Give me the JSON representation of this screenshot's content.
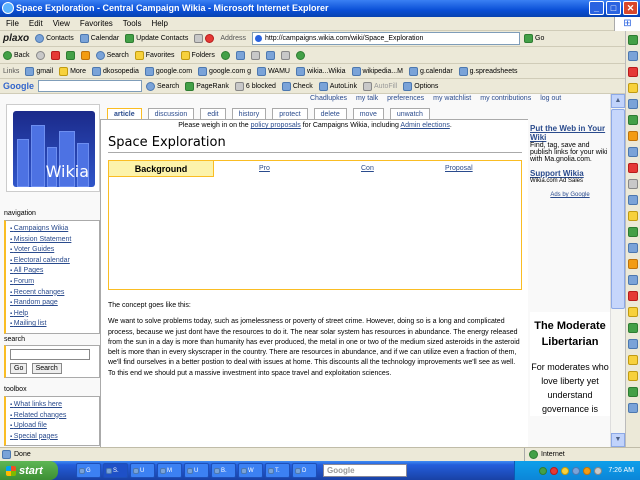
{
  "window": {
    "title": "Space Exploration - Central Campaign Wikia - Microsoft Internet Explorer"
  },
  "menu": [
    "File",
    "Edit",
    "View",
    "Favorites",
    "Tools",
    "Help"
  ],
  "plaxo_bar": {
    "brand": "plaxo",
    "contacts": "Contacts",
    "calendar": "Calendar",
    "update": "Update Contacts"
  },
  "address": {
    "label": "Address",
    "url": "http://campaigns.wikia.com/wiki/Space_Exploration",
    "go": "Go"
  },
  "nav_toolbar": {
    "back": "Back",
    "search": "Search",
    "favorites": "Favorites",
    "folders": "Folders"
  },
  "links_bar": {
    "label": "Links",
    "items": [
      "gmail",
      "More",
      "dkosopedia",
      "google.com",
      "google.com g",
      "WAMU",
      "wikia...Wikia",
      "wikipedia...M",
      "g.calendar",
      "g.spreadsheets"
    ]
  },
  "google_bar": {
    "brand": "Google",
    "search": "Search",
    "pagerank": "PageRank",
    "blocked": "6 blocked",
    "check": "Check",
    "autolink": "AutoLink",
    "autofill": "AutoFill",
    "options": "Options"
  },
  "user_links": [
    "Chadlupkes",
    "my talk",
    "preferences",
    "my watchlist",
    "my contributions",
    "log out"
  ],
  "page_tabs": [
    "article",
    "discussion",
    "edit",
    "history",
    "protect",
    "delete",
    "move",
    "unwatch"
  ],
  "logo_text": "Wikia",
  "sitenotice": {
    "before": "Please weigh in on the ",
    "link1": "policy proposals",
    "middle": " for Campaigns Wikia, including ",
    "link2": "Admin elections",
    "after": "."
  },
  "page_title": "Space Exploration",
  "content_tabs": [
    "Background",
    "Pro",
    "Con",
    "Proposal"
  ],
  "body": {
    "intro": "The concept goes like this:",
    "paragraph": "We want to solve problems today, such as jomelessness or poverty of street crime. However, doing so is a long and complicated process, because we just dont have the resources to do it. The near solar system has resources in abundance. The energy released from the sun in a day is more than humanity has ever produced, the metal in one or two of the medium sized asteroids in the asteroid belt is more than in every skyscraper in the country. There are resources in abundance, and if we can utilize even a fraction of them, we'll find ourselves in a better postion to deal with issues at home. This discounts all the technology improvements we'll see as well. To this end we should put a massive investment into space travel and exploitation sciences."
  },
  "navigation": {
    "title": "navigation",
    "items": [
      "Campaigns Wikia",
      "Mission Statement",
      "Voter Guides",
      "Electoral calendar",
      "All Pages",
      "Forum",
      "Recent changes",
      "Random page",
      "Help",
      "Mailing list"
    ]
  },
  "search_box": {
    "title": "search",
    "go": "Go",
    "search": "Search"
  },
  "toolbox": {
    "title": "toolbox",
    "items": [
      "What links here",
      "Related changes",
      "Upload file",
      "Special pages"
    ]
  },
  "ads": [
    {
      "title": "Put the Web in Your Wiki",
      "text": "Find, tag, save and publish links for your wiki with Ma.gnolia.com.",
      "domain": ""
    },
    {
      "title": "Support Wikia",
      "text": "",
      "domain": "Wikia.com Ad Sales"
    }
  ],
  "ads_by": "Ads by Google",
  "promo": {
    "heading": "The Moderate Libertarian",
    "text": "For moderates who love liberty yet understand governance is"
  },
  "status": {
    "text": "Done",
    "zone": "Internet"
  },
  "taskbar": {
    "start": "start",
    "buttons": [
      "G",
      "S.",
      "U",
      "M",
      "U",
      "B.",
      "W",
      "T.",
      "D"
    ],
    "search_placeholder": "Google",
    "clock": "7:26 AM"
  },
  "colors": {
    "title_bar": "#0a4fd6",
    "link": "#2a4b8d",
    "tab_highlight": "#fcf3ab",
    "tab_border": "#fabd23",
    "taskbar": "#245edb",
    "start": "#3c8f34"
  }
}
